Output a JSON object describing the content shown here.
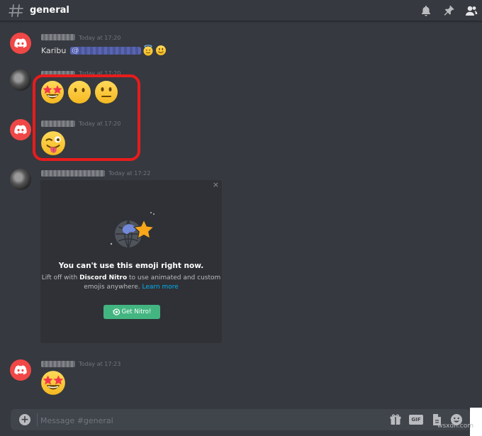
{
  "header": {
    "channel_name": "general",
    "icons": [
      "hash-icon",
      "bell-icon",
      "pin-icon",
      "members-icon"
    ]
  },
  "messages": [
    {
      "avatar": "discord-logo",
      "timestamp": "Today at 17:20",
      "text": "Karibu",
      "mention": "@",
      "emojis": [
        "smiling-face-with-halo",
        "smiling-face"
      ]
    },
    {
      "avatar": "photo",
      "timestamp": "Today at 17:20",
      "emojis": [
        "star-struck",
        "face-without-mouth",
        "neutral-face"
      ]
    },
    {
      "avatar": "discord-logo",
      "timestamp": "Today at 17:20",
      "emojis": [
        "winking-face-with-tongue"
      ]
    },
    {
      "avatar": "photo",
      "timestamp": "Today at 17:22"
    },
    {
      "avatar": "discord-logo",
      "timestamp": "Today at 17:23",
      "emojis": [
        "star-struck"
      ]
    }
  ],
  "nitro_card": {
    "close": "×",
    "title": "You can't use this emoji right now.",
    "desc_1": "Lift off with ",
    "desc_bold": "Discord Nitro",
    "desc_2": " to use animated and custom",
    "desc_3": "emojis anywhere. ",
    "learn_more": "Learn more",
    "button": "Get Nitro!"
  },
  "composer": {
    "placeholder": "Message #general",
    "icons": [
      "plus-icon",
      "gift-icon",
      "gif-icon",
      "file-icon",
      "emoji-icon"
    ],
    "gif_label": "GIF"
  },
  "watermark": "wsxdn.com",
  "colors": {
    "background": "#36393f",
    "discord_red": "#f04747",
    "highlight": "#e81c1c",
    "nitro_green": "#43b581",
    "link": "#00b0f4"
  }
}
